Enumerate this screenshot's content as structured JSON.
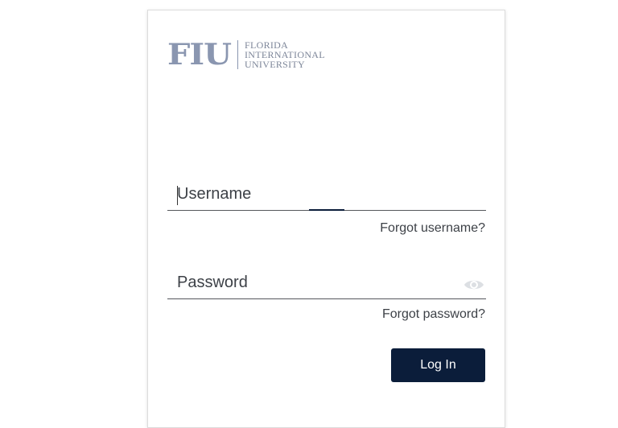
{
  "logo": {
    "mark": "FIU",
    "line1": "FLORIDA",
    "line2": "INTERNATIONAL",
    "line3": "UNIVERSITY"
  },
  "form": {
    "username": {
      "placeholder": "Username",
      "value": ""
    },
    "password": {
      "placeholder": "Password",
      "value": ""
    },
    "forgot_username": "Forgot username?",
    "forgot_password": "Forgot password?",
    "login_label": "Log In"
  },
  "colors": {
    "brand_navy": "#0b1d3a",
    "logo_gray_blue": "#8a96b0"
  },
  "icons": {
    "password_toggle": "eye-icon"
  }
}
